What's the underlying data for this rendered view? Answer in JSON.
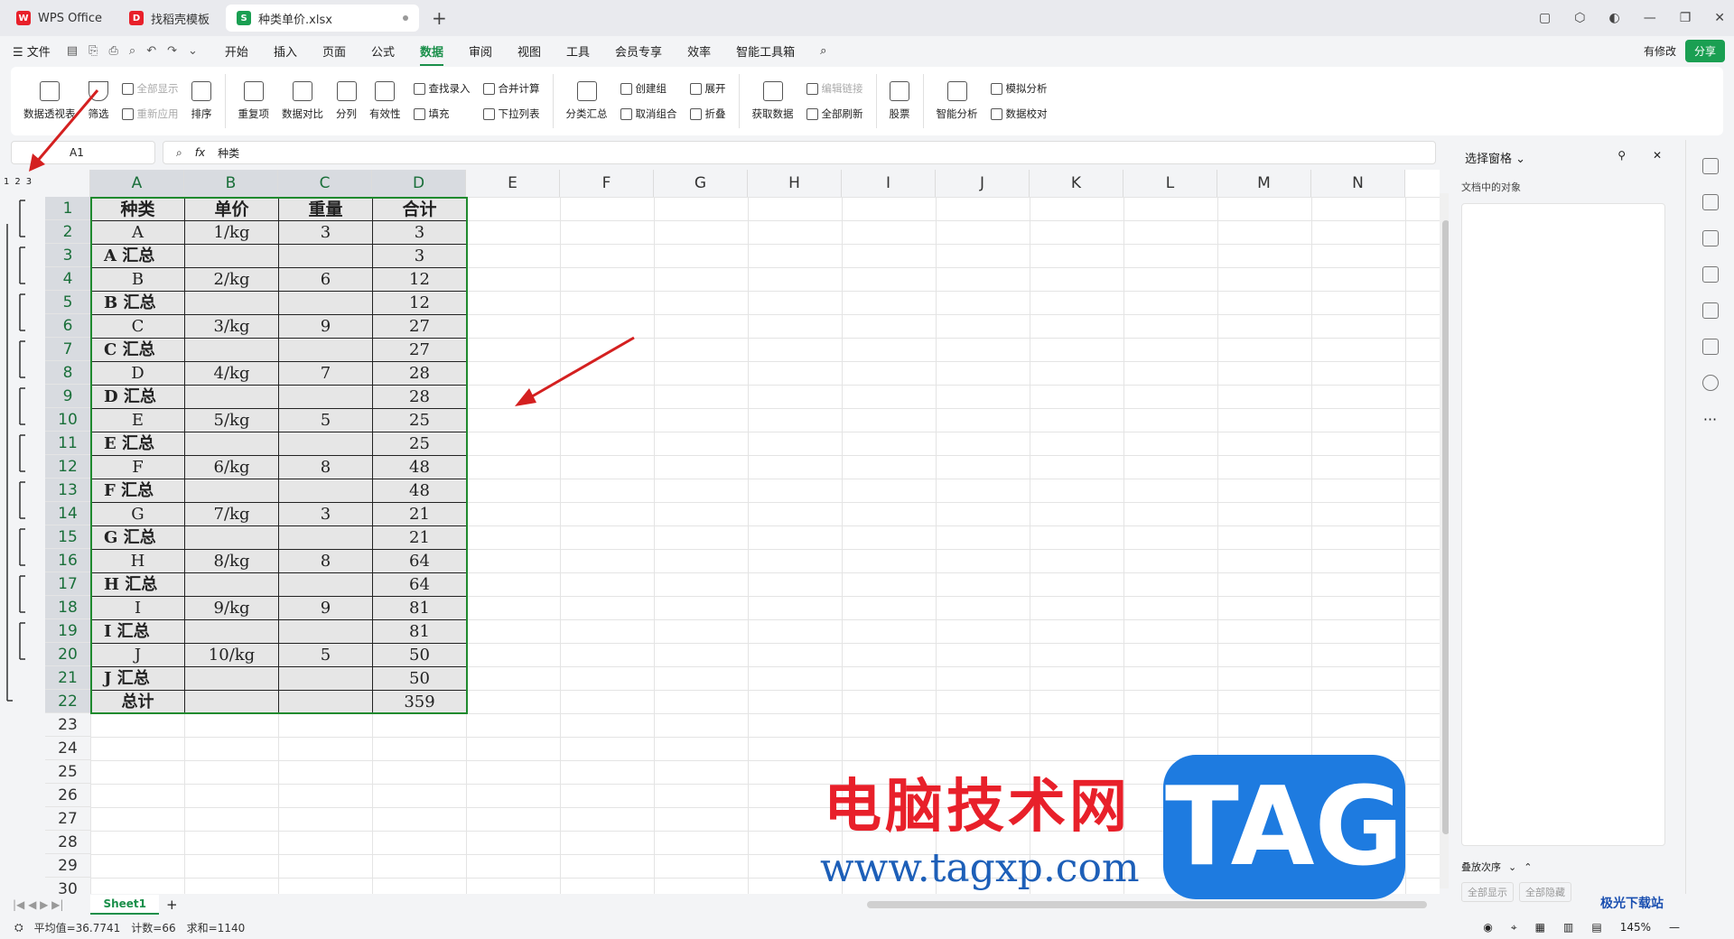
{
  "tabs": [
    {
      "label": "WPS Office",
      "icon": "wps-logo-icon",
      "color": "#e8202a"
    },
    {
      "label": "找稻壳模板",
      "icon": "docer-icon",
      "color": "#e8202a"
    },
    {
      "label": "种类单价.xlsx",
      "icon": "sheet-file-icon",
      "color": "#1a9f52"
    }
  ],
  "menu": {
    "file": "文件",
    "items": [
      "开始",
      "插入",
      "页面",
      "公式",
      "数据",
      "审阅",
      "视图",
      "工具",
      "会员专享",
      "效率",
      "智能工具箱"
    ],
    "active": "数据"
  },
  "share": {
    "modified": "有修改",
    "share": "分享"
  },
  "ribbon": {
    "pivot": "数据透视表",
    "filter": "筛选",
    "show_all": "全部显示",
    "reapply": "重新应用",
    "sort": "排序",
    "dup": "重复项",
    "compare": "数据对比",
    "split": "分列",
    "validity": "有效性",
    "find_entry": "查找录入",
    "fill": "填充",
    "merge_calc": "合并计算",
    "dropdown": "下拉列表",
    "subtotal": "分类汇总",
    "create_group": "创建组",
    "ungroup": "取消组合",
    "expand": "展开",
    "collapse": "折叠",
    "get_data": "获取数据",
    "edit_link": "编辑链接",
    "refresh_all": "全部刷新",
    "stock": "股票",
    "smart": "智能分析",
    "simulate": "模拟分析",
    "verify": "数据校对"
  },
  "formula": {
    "cell": "A1",
    "fx": "fx",
    "content": "种类"
  },
  "outline_levels": [
    "1",
    "2",
    "3"
  ],
  "columns": [
    "A",
    "B",
    "C",
    "D",
    "E",
    "F",
    "G",
    "H",
    "I",
    "J",
    "K",
    "L",
    "M",
    "N"
  ],
  "rows": [
    "1",
    "2",
    "3",
    "4",
    "5",
    "6",
    "7",
    "8",
    "9",
    "10",
    "11",
    "12",
    "13",
    "14",
    "15",
    "16",
    "17",
    "18",
    "19",
    "20",
    "21",
    "22",
    "23",
    "24",
    "25",
    "26",
    "27",
    "28",
    "29",
    "30"
  ],
  "table": {
    "header": [
      "种类",
      "单价",
      "重量",
      "合计"
    ],
    "body": [
      [
        "A",
        "1/kg",
        "3",
        "3"
      ],
      [
        "A 汇总",
        "",
        "",
        "3"
      ],
      [
        "B",
        "2/kg",
        "6",
        "12"
      ],
      [
        "B 汇总",
        "",
        "",
        "12"
      ],
      [
        "C",
        "3/kg",
        "9",
        "27"
      ],
      [
        "C 汇总",
        "",
        "",
        "27"
      ],
      [
        "D",
        "4/kg",
        "7",
        "28"
      ],
      [
        "D 汇总",
        "",
        "",
        "28"
      ],
      [
        "E",
        "5/kg",
        "5",
        "25"
      ],
      [
        "E 汇总",
        "",
        "",
        "25"
      ],
      [
        "F",
        "6/kg",
        "8",
        "48"
      ],
      [
        "F 汇总",
        "",
        "",
        "48"
      ],
      [
        "G",
        "7/kg",
        "3",
        "21"
      ],
      [
        "G 汇总",
        "",
        "",
        "21"
      ],
      [
        "H",
        "8/kg",
        "8",
        "64"
      ],
      [
        "H 汇总",
        "",
        "",
        "64"
      ],
      [
        "I",
        "9/kg",
        "9",
        "81"
      ],
      [
        "I 汇总",
        "",
        "",
        "81"
      ],
      [
        "J",
        "10/kg",
        "5",
        "50"
      ],
      [
        "J 汇总",
        "",
        "",
        "50"
      ],
      [
        "总计",
        "",
        "",
        "359"
      ]
    ]
  },
  "sheet_tab": "Sheet1",
  "status": {
    "avg": "平均值=36.7741",
    "count": "计数=66",
    "sum": "求和=1140",
    "zoom": "145%"
  },
  "pane": {
    "title": "选择窗格",
    "sub": "文档中的对象",
    "order": "叠放次序",
    "show_all": "全部显示",
    "hide_all": "全部隐藏"
  },
  "watermark": {
    "cn": "电脑技术网",
    "url": "www.tagxp.com",
    "tag": "TAG",
    "site": "极光下载站"
  }
}
